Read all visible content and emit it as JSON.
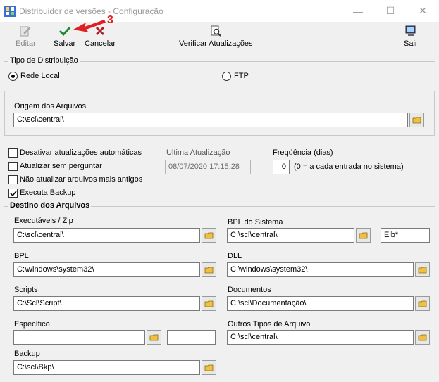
{
  "window": {
    "title": "Distribuidor de versões - Configuração",
    "minimize_glyph": "—",
    "maximize_glyph": "☐",
    "close_glyph": "✕",
    "annotation_number": "3",
    "annotation_color": "#e02020"
  },
  "toolbar": {
    "edit_label": "Editar",
    "save_label": "Salvar",
    "cancel_label": "Cancelar",
    "check_updates_label": "Verificar Atualizações",
    "exit_label": "Sair"
  },
  "distribution": {
    "group_label": "Tipo de Distribuição",
    "local_label": "Rede Local",
    "ftp_label": "FTP",
    "selected": "Rede Local"
  },
  "origin": {
    "label": "Origem dos Arquivos",
    "value": "C:\\scl\\central\\"
  },
  "options": {
    "disable_auto_label": "Desativar atualizações automáticas",
    "disable_auto_checked": false,
    "update_silent_label": "Atualizar sem perguntar",
    "update_silent_checked": false,
    "no_old_label": "Não atualizar arquivos mais antigos",
    "no_old_checked": false,
    "backup_label": "Executa Backup",
    "backup_checked": true
  },
  "last_update": {
    "label": "Ultima Atualização",
    "value": "08/07/2020 17:15:28"
  },
  "frequency": {
    "label": "Freqüência (dias)",
    "value": "0",
    "hint": "(0 = a cada entrada no sistema)"
  },
  "destination": {
    "group_label": "Destino dos Arquivos",
    "executables_label": "Executáveis / Zip",
    "executables_value": "C:\\scl\\central\\",
    "bpl_system_label": "BPL do Sistema",
    "bpl_system_value": "C:\\scl\\central\\",
    "bpl_system_mask": "Elb*",
    "bpl_label": "BPL",
    "bpl_value": "C:\\windows\\system32\\",
    "dll_label": "DLL",
    "dll_value": "C:\\windows\\system32\\",
    "scripts_label": "Scripts",
    "scripts_value": "C:\\Scl\\Script\\",
    "documents_label": "Documentos",
    "documents_value": "C:\\scl\\Documentação\\",
    "specific_label": "Específico",
    "specific_value": "",
    "specific_ext_value": "",
    "other_label": "Outros Tipos de Arquivo",
    "other_value": "C:\\scl\\central\\",
    "backup_label": "Backup",
    "backup_value": "C:\\scl\\Bkp\\"
  }
}
